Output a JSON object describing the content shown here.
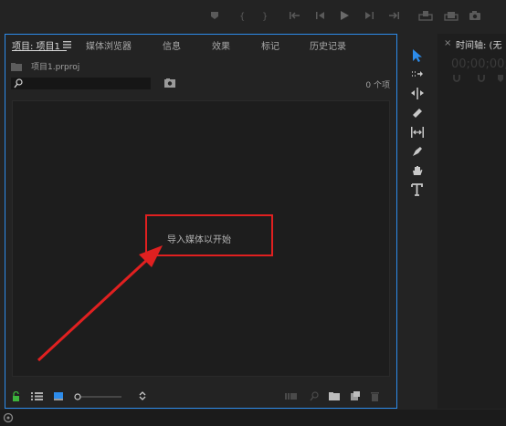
{
  "project_panel": {
    "tabs": [
      {
        "label": "项目: 项目1"
      },
      {
        "label": "媒体浏览器"
      },
      {
        "label": "信息"
      },
      {
        "label": "效果"
      },
      {
        "label": "标记"
      },
      {
        "label": "历史记录"
      }
    ],
    "menu_icon": "hamburger-menu-icon",
    "file_name": "项目1.prproj",
    "search": {
      "value": "",
      "placeholder": ""
    },
    "item_count": "0 个项",
    "empty_message": "导入媒体以开始",
    "annotation": {
      "color": "#e02020"
    },
    "bottom_icons": [
      "lock-icon",
      "list-view-icon",
      "icon-view-icon",
      "zoom-slider",
      "sort-icon",
      "automate-to-sequence-icon",
      "find-icon",
      "new-bin-icon",
      "new-item-icon",
      "clear-icon"
    ]
  },
  "tools": [
    "selection-tool-icon",
    "track-select-tool-icon",
    "ripple-edit-tool-icon",
    "razor-tool-icon",
    "slip-tool-icon",
    "pen-tool-icon",
    "hand-tool-icon",
    "type-tool-icon"
  ],
  "timeline_panel": {
    "title": "时间轴: (无",
    "timecode": "00;00;00;0"
  },
  "colors": {
    "accent": "#2d8ceb",
    "panel_bg": "#232323",
    "annotation_red": "#e02020",
    "lock_green": "#3cb43c"
  }
}
